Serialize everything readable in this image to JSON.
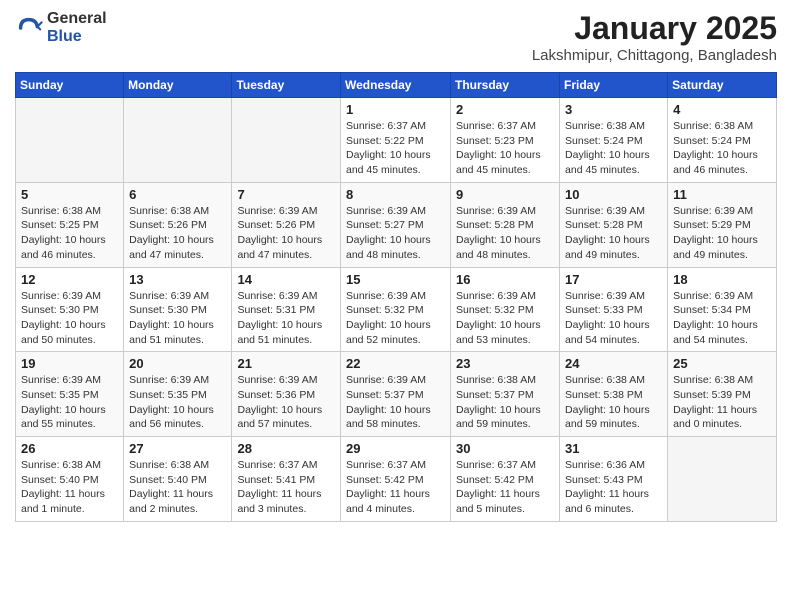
{
  "logo": {
    "general": "General",
    "blue": "Blue"
  },
  "header": {
    "month": "January 2025",
    "location": "Lakshmipur, Chittagong, Bangladesh"
  },
  "weekdays": [
    "Sunday",
    "Monday",
    "Tuesday",
    "Wednesday",
    "Thursday",
    "Friday",
    "Saturday"
  ],
  "weeks": [
    [
      {
        "day": "",
        "info": ""
      },
      {
        "day": "",
        "info": ""
      },
      {
        "day": "",
        "info": ""
      },
      {
        "day": "1",
        "info": "Sunrise: 6:37 AM\nSunset: 5:22 PM\nDaylight: 10 hours\nand 45 minutes."
      },
      {
        "day": "2",
        "info": "Sunrise: 6:37 AM\nSunset: 5:23 PM\nDaylight: 10 hours\nand 45 minutes."
      },
      {
        "day": "3",
        "info": "Sunrise: 6:38 AM\nSunset: 5:24 PM\nDaylight: 10 hours\nand 45 minutes."
      },
      {
        "day": "4",
        "info": "Sunrise: 6:38 AM\nSunset: 5:24 PM\nDaylight: 10 hours\nand 46 minutes."
      }
    ],
    [
      {
        "day": "5",
        "info": "Sunrise: 6:38 AM\nSunset: 5:25 PM\nDaylight: 10 hours\nand 46 minutes."
      },
      {
        "day": "6",
        "info": "Sunrise: 6:38 AM\nSunset: 5:26 PM\nDaylight: 10 hours\nand 47 minutes."
      },
      {
        "day": "7",
        "info": "Sunrise: 6:39 AM\nSunset: 5:26 PM\nDaylight: 10 hours\nand 47 minutes."
      },
      {
        "day": "8",
        "info": "Sunrise: 6:39 AM\nSunset: 5:27 PM\nDaylight: 10 hours\nand 48 minutes."
      },
      {
        "day": "9",
        "info": "Sunrise: 6:39 AM\nSunset: 5:28 PM\nDaylight: 10 hours\nand 48 minutes."
      },
      {
        "day": "10",
        "info": "Sunrise: 6:39 AM\nSunset: 5:28 PM\nDaylight: 10 hours\nand 49 minutes."
      },
      {
        "day": "11",
        "info": "Sunrise: 6:39 AM\nSunset: 5:29 PM\nDaylight: 10 hours\nand 49 minutes."
      }
    ],
    [
      {
        "day": "12",
        "info": "Sunrise: 6:39 AM\nSunset: 5:30 PM\nDaylight: 10 hours\nand 50 minutes."
      },
      {
        "day": "13",
        "info": "Sunrise: 6:39 AM\nSunset: 5:30 PM\nDaylight: 10 hours\nand 51 minutes."
      },
      {
        "day": "14",
        "info": "Sunrise: 6:39 AM\nSunset: 5:31 PM\nDaylight: 10 hours\nand 51 minutes."
      },
      {
        "day": "15",
        "info": "Sunrise: 6:39 AM\nSunset: 5:32 PM\nDaylight: 10 hours\nand 52 minutes."
      },
      {
        "day": "16",
        "info": "Sunrise: 6:39 AM\nSunset: 5:32 PM\nDaylight: 10 hours\nand 53 minutes."
      },
      {
        "day": "17",
        "info": "Sunrise: 6:39 AM\nSunset: 5:33 PM\nDaylight: 10 hours\nand 54 minutes."
      },
      {
        "day": "18",
        "info": "Sunrise: 6:39 AM\nSunset: 5:34 PM\nDaylight: 10 hours\nand 54 minutes."
      }
    ],
    [
      {
        "day": "19",
        "info": "Sunrise: 6:39 AM\nSunset: 5:35 PM\nDaylight: 10 hours\nand 55 minutes."
      },
      {
        "day": "20",
        "info": "Sunrise: 6:39 AM\nSunset: 5:35 PM\nDaylight: 10 hours\nand 56 minutes."
      },
      {
        "day": "21",
        "info": "Sunrise: 6:39 AM\nSunset: 5:36 PM\nDaylight: 10 hours\nand 57 minutes."
      },
      {
        "day": "22",
        "info": "Sunrise: 6:39 AM\nSunset: 5:37 PM\nDaylight: 10 hours\nand 58 minutes."
      },
      {
        "day": "23",
        "info": "Sunrise: 6:38 AM\nSunset: 5:37 PM\nDaylight: 10 hours\nand 59 minutes."
      },
      {
        "day": "24",
        "info": "Sunrise: 6:38 AM\nSunset: 5:38 PM\nDaylight: 10 hours\nand 59 minutes."
      },
      {
        "day": "25",
        "info": "Sunrise: 6:38 AM\nSunset: 5:39 PM\nDaylight: 11 hours\nand 0 minutes."
      }
    ],
    [
      {
        "day": "26",
        "info": "Sunrise: 6:38 AM\nSunset: 5:40 PM\nDaylight: 11 hours\nand 1 minute."
      },
      {
        "day": "27",
        "info": "Sunrise: 6:38 AM\nSunset: 5:40 PM\nDaylight: 11 hours\nand 2 minutes."
      },
      {
        "day": "28",
        "info": "Sunrise: 6:37 AM\nSunset: 5:41 PM\nDaylight: 11 hours\nand 3 minutes."
      },
      {
        "day": "29",
        "info": "Sunrise: 6:37 AM\nSunset: 5:42 PM\nDaylight: 11 hours\nand 4 minutes."
      },
      {
        "day": "30",
        "info": "Sunrise: 6:37 AM\nSunset: 5:42 PM\nDaylight: 11 hours\nand 5 minutes."
      },
      {
        "day": "31",
        "info": "Sunrise: 6:36 AM\nSunset: 5:43 PM\nDaylight: 11 hours\nand 6 minutes."
      },
      {
        "day": "",
        "info": ""
      }
    ]
  ]
}
